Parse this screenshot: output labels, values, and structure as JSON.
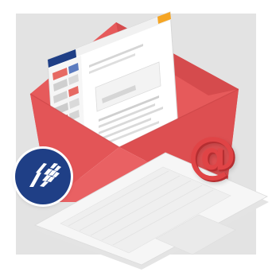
{
  "illustration": {
    "at_symbol": "@",
    "logo_icon": "grid-sail-logo-icon",
    "colors": {
      "panel": "#e3e3e3",
      "envelope_red": "#e65a5b",
      "envelope_dark": "#c94446",
      "laptop": "#f3f3f3",
      "badge_blue": "#1f3f86"
    }
  }
}
